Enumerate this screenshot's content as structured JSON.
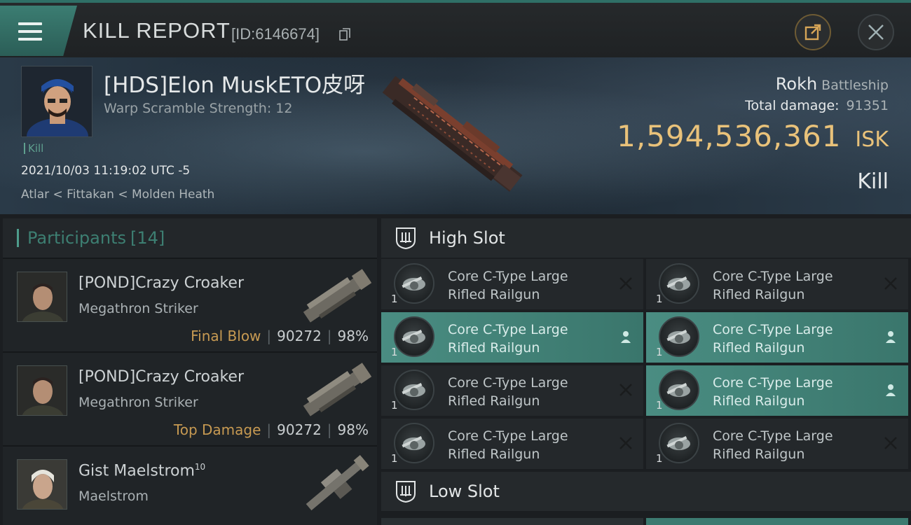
{
  "header": {
    "title": "KILL REPORT",
    "report_id": "[ID:6146674]"
  },
  "victim": {
    "pilot": "[HDS]Elon MuskETO皮呀",
    "warp_scramble": "Warp Scramble Strength: 12",
    "kill_tag": "Kill",
    "datetime": "2021/10/03 11:19:02 UTC -5",
    "location": "Atlar < Fittakan < Molden Heath",
    "ship_name": "Rokh",
    "ship_class": "Battleship",
    "total_damage_label": "Total damage:",
    "total_damage": "91351",
    "isk_value": "1,594,536,361",
    "isk_unit": "ISK",
    "report_type": "Kill"
  },
  "participants": {
    "label": "Participants",
    "count": "[14]",
    "rows": [
      {
        "name": "[POND]Crazy Croaker",
        "ship": "Megathron Striker",
        "role": "Final Blow",
        "damage": "90272",
        "percent": "98%"
      },
      {
        "name": "[POND]Crazy Croaker",
        "ship": "Megathron Striker",
        "role": "Top Damage",
        "damage": "90272",
        "percent": "98%"
      },
      {
        "name": "Gist Maelstrom",
        "name_sup": "10",
        "ship": "Maelstrom"
      }
    ]
  },
  "slots": {
    "high_label": "High Slot",
    "low_label": "Low Slot",
    "modules": [
      {
        "line1": "Core C-Type Large",
        "line2": "Rifled Railgun",
        "qty": "1",
        "status": "destroyed"
      },
      {
        "line1": "Core C-Type Large",
        "line2": "Rifled Railgun",
        "qty": "1",
        "status": "destroyed"
      },
      {
        "line1": "Core C-Type Large",
        "line2": "Rifled Railgun",
        "qty": "1",
        "status": "dropped"
      },
      {
        "line1": "Core C-Type Large",
        "line2": "Rifled Railgun",
        "qty": "1",
        "status": "dropped"
      },
      {
        "line1": "Core C-Type Large",
        "line2": "Rifled Railgun",
        "qty": "1",
        "status": "destroyed"
      },
      {
        "line1": "Core C-Type Large",
        "line2": "Rifled Railgun",
        "qty": "1",
        "status": "dropped"
      },
      {
        "line1": "Core C-Type Large",
        "line2": "Rifled Railgun",
        "qty": "1",
        "status": "destroyed"
      },
      {
        "line1": "Core C-Type Large",
        "line2": "Rifled Railgun",
        "qty": "1",
        "status": "destroyed"
      }
    ]
  },
  "icons": {
    "menu": "menu-icon",
    "copy": "copy-icon",
    "share": "share-icon",
    "close": "close-icon",
    "slot": "slot-icon",
    "destroyed": "x-icon",
    "dropped": "person-icon"
  },
  "colors": {
    "accent_teal": "#3d7f72",
    "isk_gold": "#e9c27a",
    "final_blow": "#c79a52"
  }
}
